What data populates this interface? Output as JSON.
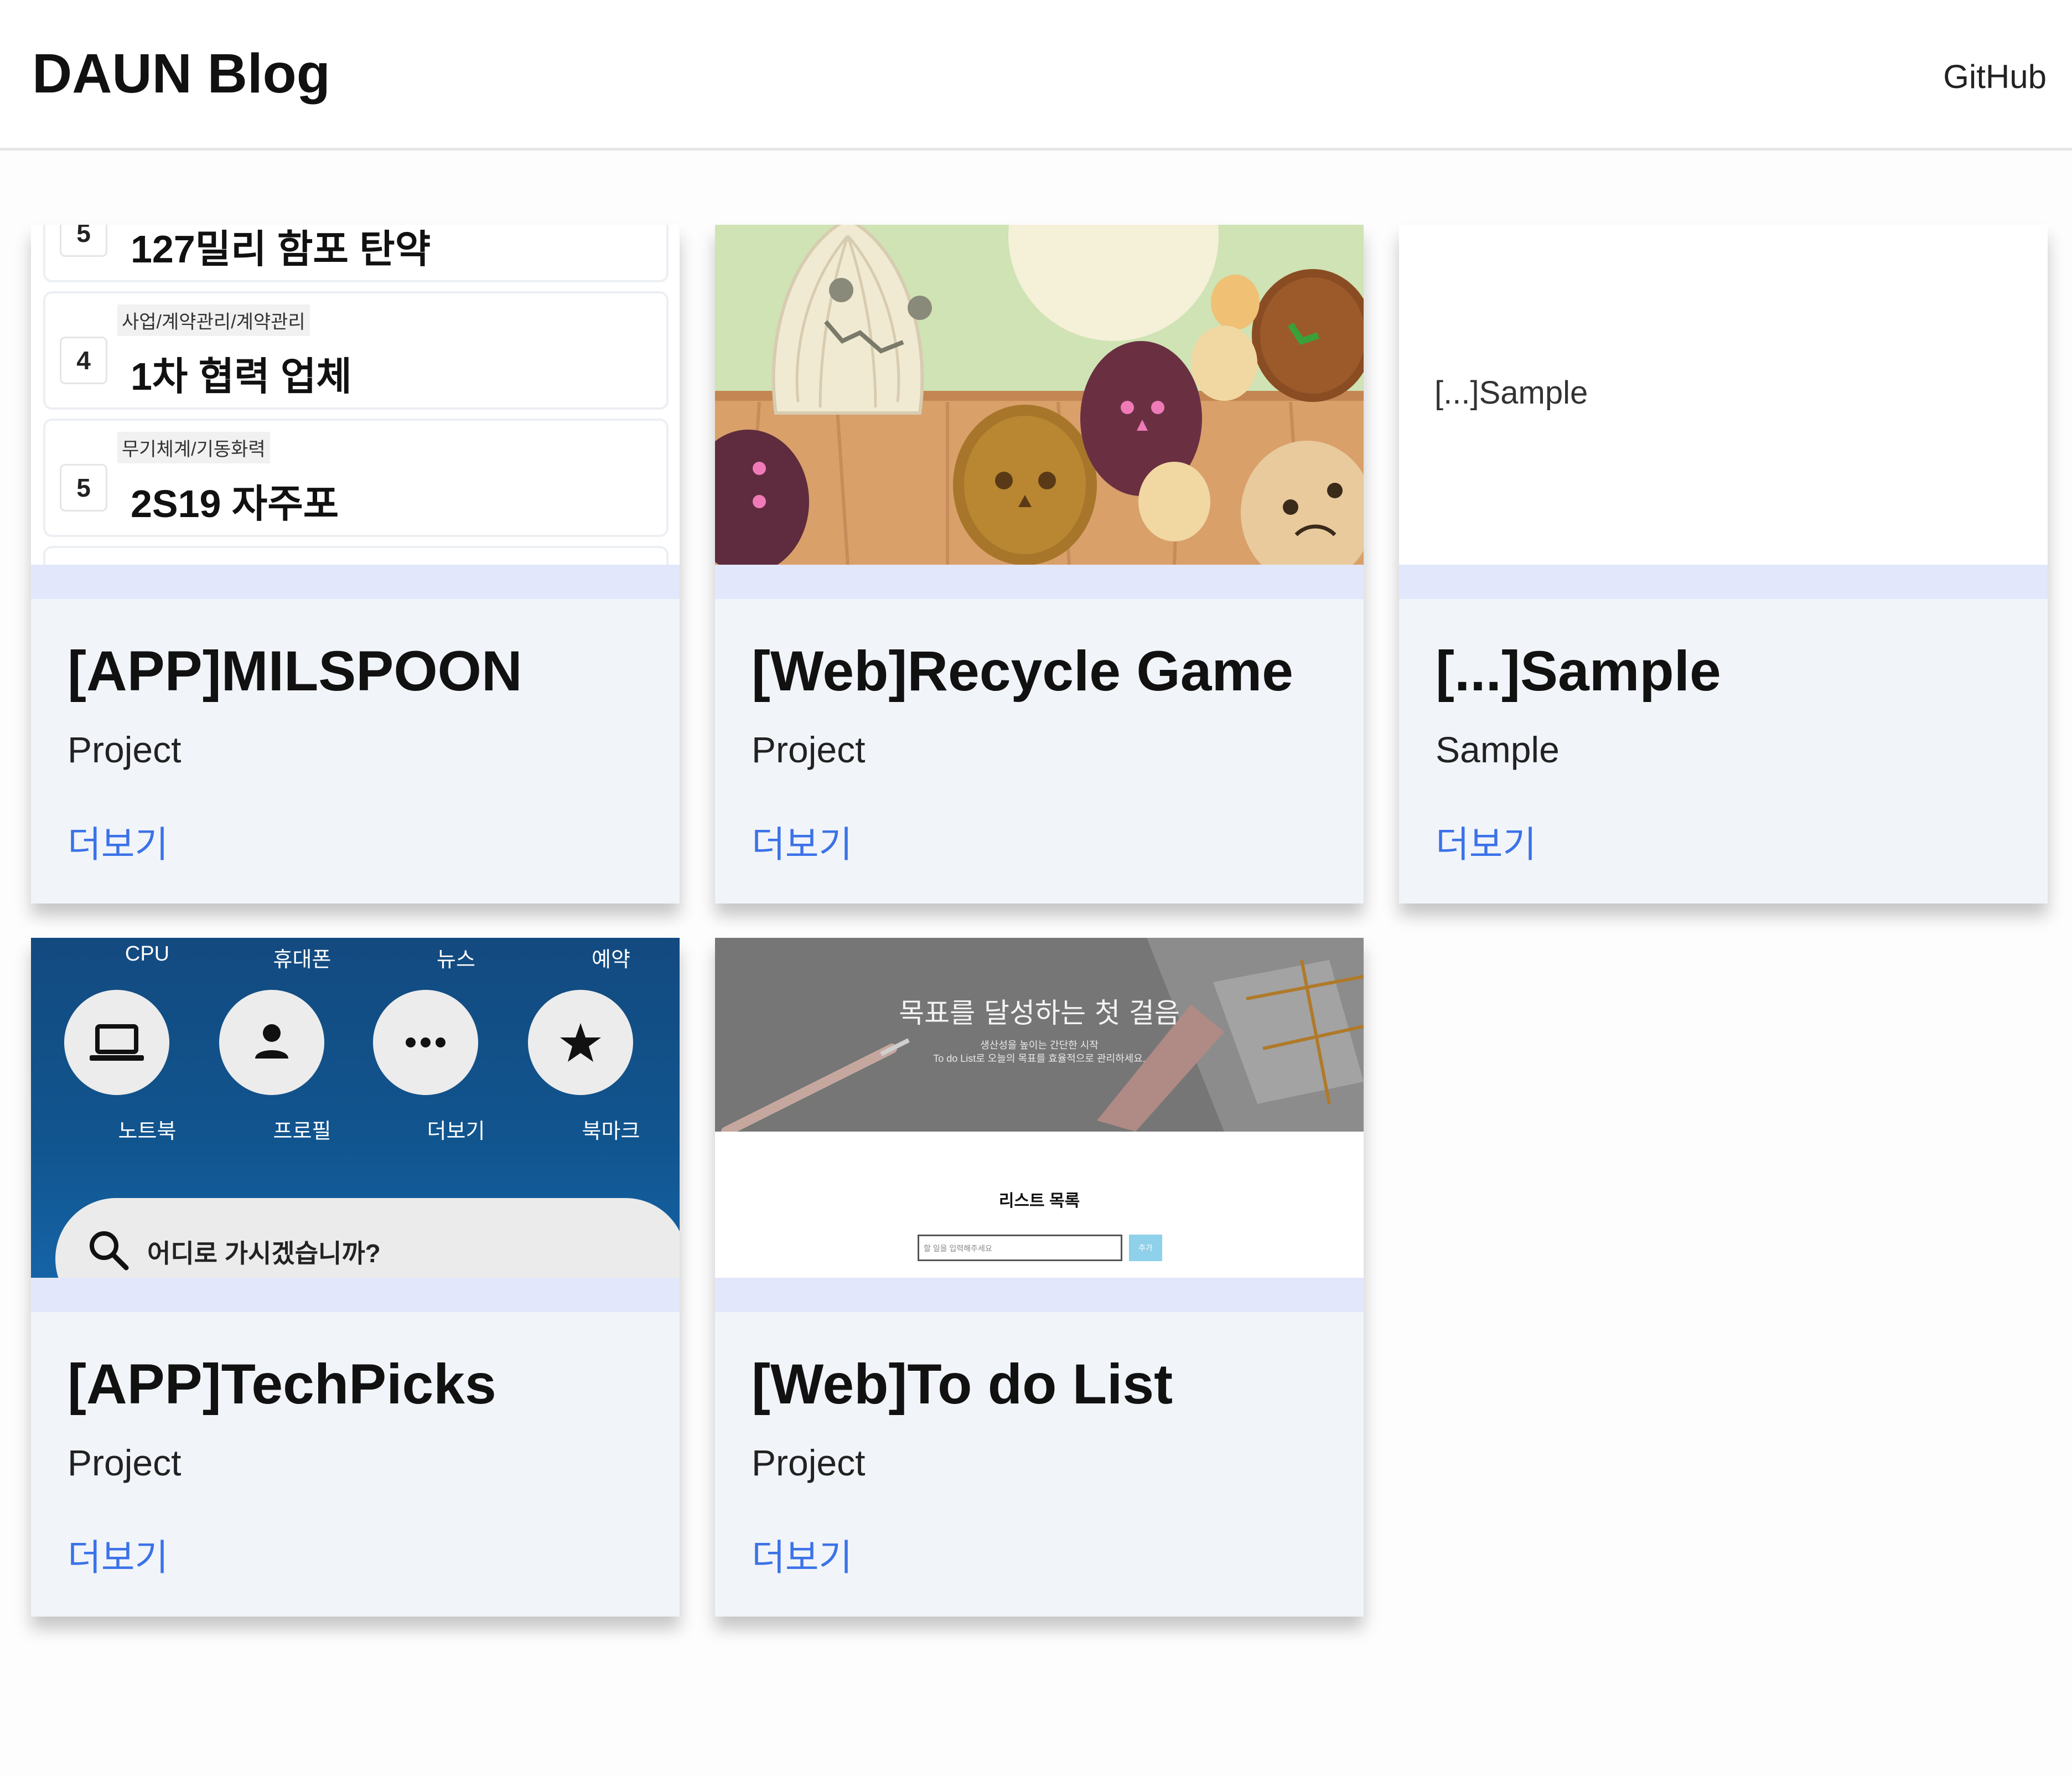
{
  "header": {
    "logo": "DAUN Blog",
    "nav_github": "GitHub"
  },
  "colors": {
    "accent_link": "#3b72e8",
    "card_bg": "#f1f4f9",
    "card_band": "#e2e7fb"
  },
  "cards": [
    {
      "title": "[APP]MILSPOON",
      "category": "Project",
      "more": "더보기",
      "thumb": {
        "items": [
          {
            "num": "5",
            "tag": "",
            "title": "127밀리 함포 탄약"
          },
          {
            "num": "4",
            "tag": "사업/계약관리/계약관리",
            "title": "1차 협력 업체"
          },
          {
            "num": "5",
            "tag": "무기체계/기동화력",
            "title": "2S19 자주포"
          }
        ]
      }
    },
    {
      "title": "[Web]Recycle Game",
      "category": "Project",
      "more": "더보기"
    },
    {
      "title": "[...]Sample",
      "category": "Sample",
      "more": "더보기",
      "thumb": {
        "text": "[...]Sample"
      }
    },
    {
      "title": "[APP]TechPicks",
      "category": "Project",
      "more": "더보기",
      "thumb": {
        "top_labels": [
          "CPU",
          "휴대폰",
          "뉴스",
          "예약"
        ],
        "buttons": [
          {
            "label": "노트북",
            "icon": "laptop-icon"
          },
          {
            "label": "프로필",
            "icon": "person-icon"
          },
          {
            "label": "더보기",
            "icon": "more-dots-icon"
          },
          {
            "label": "북마크",
            "icon": "star-icon"
          }
        ],
        "search_placeholder": "어디로 가시겠습니까?"
      }
    },
    {
      "title": "[Web]To do List",
      "category": "Project",
      "more": "더보기",
      "thumb": {
        "heading": "목표를 달성하는 첫 걸음",
        "subtext_1": "생산성을 높이는 간단한 시작",
        "subtext_2": "To do List로 오늘의 목표를 효율적으로 관리하세요.",
        "list_title": "리스트 목록",
        "input_placeholder": "할 일을 입력해주세요",
        "button": "추가"
      }
    }
  ]
}
